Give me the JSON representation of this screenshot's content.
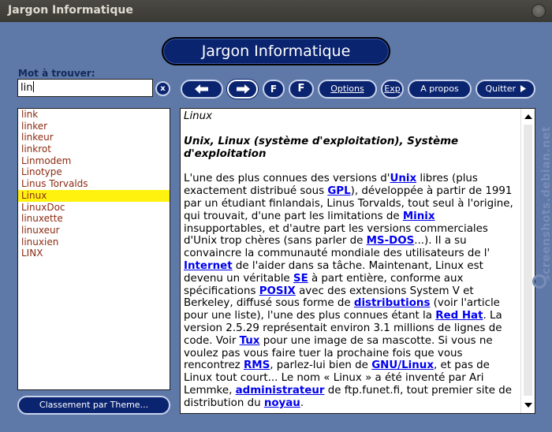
{
  "window": {
    "title": "Jargon Informatique"
  },
  "banner": {
    "title": "Jargon Informatique"
  },
  "search": {
    "label": "Mot à trouver:",
    "value": "lin",
    "clear_label": "x"
  },
  "toolbar": {
    "back_icon": "arrow-left-icon",
    "forward_icon": "arrow-right-icon",
    "font_smaller_label": "F",
    "font_larger_label": "F",
    "options_label": "Options",
    "exp_label": "Exp",
    "apropos_label": "A propos",
    "quitter_label": "Quitter"
  },
  "wordlist": {
    "items": [
      "link",
      "linker",
      "linkeur",
      "linkrot",
      "Linmodem",
      "Linotype",
      "Linus Torvalds",
      "Linux",
      "LinuxDoc",
      "linuxette",
      "linuxeur",
      "linuxien",
      "LINX"
    ],
    "selected": "Linux"
  },
  "theme_button": {
    "label": "Classement par Theme..."
  },
  "article": {
    "entry": "Linux",
    "heading": "Unix, Linux (système d'exploitation), Système d'exploitation",
    "body": [
      {
        "t": "L'une des plus connues des versions d'"
      },
      {
        "link": "Unix"
      },
      {
        "t": " libres (plus exactement distribué sous "
      },
      {
        "link": "GPL"
      },
      {
        "t": "), développée à partir de 1991 par un étudiant finlandais, Linus Torvalds, tout seul à l'origine, qui trouvait, d'une part les limitations de "
      },
      {
        "link": "Minix"
      },
      {
        "t": " insupportables, et d'autre part les versions commerciales d'Unix trop chères (sans parler de "
      },
      {
        "link": "MS-DOS"
      },
      {
        "t": "...). Il a su convaincre la communauté mondiale des utilisateurs de l' "
      },
      {
        "link": "Internet"
      },
      {
        "t": " de l'aider dans sa tâche. Maintenant, Linux est devenu un véritable "
      },
      {
        "link": "SE"
      },
      {
        "t": " à part entière, conforme aux spécifications "
      },
      {
        "link": "POSIX"
      },
      {
        "t": " avec des extensions System V et Berkeley, diffusé sous forme de "
      },
      {
        "link": "distributions"
      },
      {
        "t": " (voir l'article pour une liste), l'une des plus connues étant la "
      },
      {
        "link": "Red Hat"
      },
      {
        "t": ". La version 2.5.29 représentait environ 3.1 millions de lignes de code. Voir "
      },
      {
        "link": "Tux"
      },
      {
        "t": " pour une image de sa mascotte. Si vous ne voulez pas vous faire tuer la prochaine fois que vous rencontrez "
      },
      {
        "link": "RMS"
      },
      {
        "t": ", parlez-lui bien de "
      },
      {
        "link": "GNU/Linux"
      },
      {
        "t": ", et pas de Linux tout court... Le nom « Linux » a été inventé par Ari Lemmke, "
      },
      {
        "link": "administrateur"
      },
      {
        "t": " de ftp.funet.fi, tout premier site de distribution du "
      },
      {
        "link": "noyau"
      },
      {
        "t": "."
      }
    ]
  },
  "watermark": {
    "text": "screenshots.debian.net"
  },
  "colors": {
    "accent": "#0b2470",
    "background": "#5e78a8",
    "selection": "#fff20f",
    "link": "#0000ee"
  }
}
